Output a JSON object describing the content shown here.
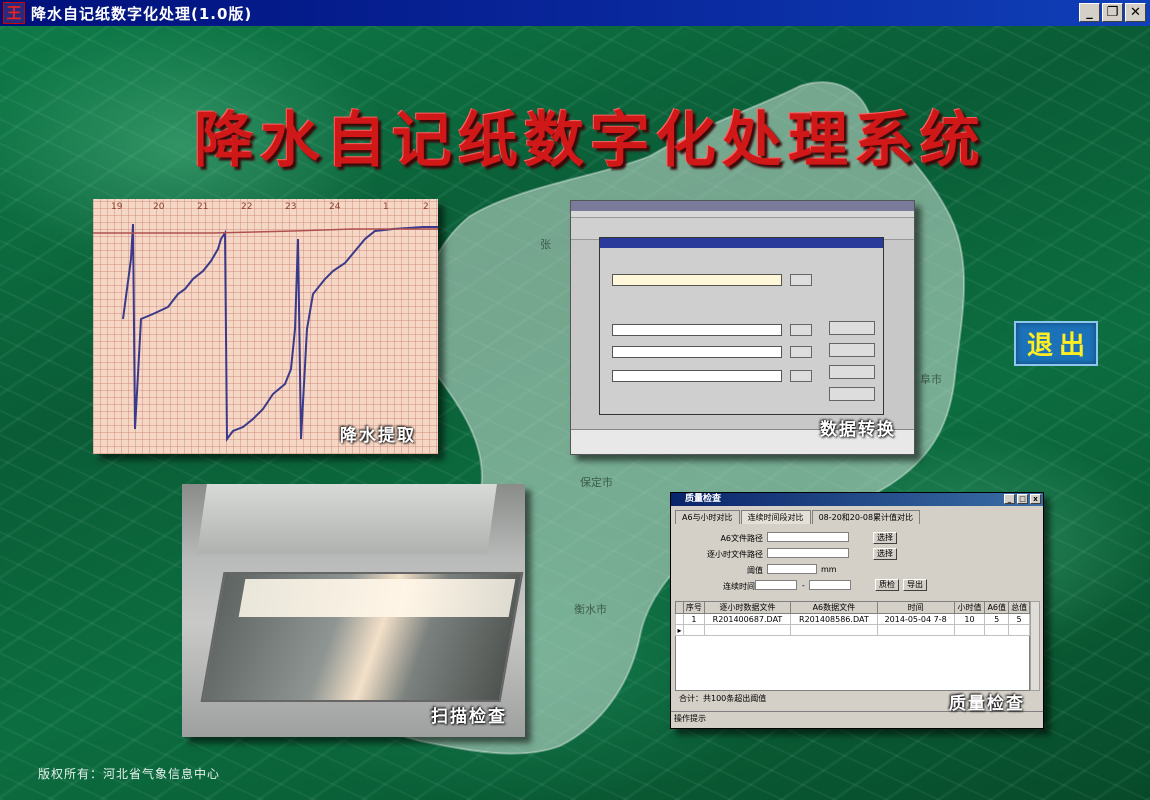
{
  "window": {
    "icon_glyph": "王",
    "title": "降水自记纸数字化处理(1.0版)",
    "minimize_glyph": "_",
    "restore_glyph": "❐",
    "close_glyph": "✕"
  },
  "header": {
    "main_title": "降水自记纸数字化处理系统"
  },
  "map": {
    "cities": [
      "张",
      "保定市",
      "衡水市",
      "阜市"
    ]
  },
  "panels": {
    "extract": {
      "label": "降水提取",
      "tick_labels": [
        "19",
        "20",
        "21",
        "22",
        "23",
        "24",
        "1",
        "2"
      ]
    },
    "convert": {
      "label": "数据转换"
    },
    "scan": {
      "label": "扫描检查"
    },
    "quality": {
      "label": "质量检查"
    }
  },
  "quality_window": {
    "title": "质量检查",
    "tabs": [
      "A6与小时对比",
      "连续时间段对比",
      "08-20和20-08累计值对比"
    ],
    "fields": {
      "a6_label": "A6文件路径",
      "hour_label": "逐小时文件路径",
      "threshold_label": "阈值",
      "threshold_unit": "mm",
      "period_label": "连续时间段",
      "period_sep": "-"
    },
    "buttons": {
      "select1": "选择",
      "select2": "选择",
      "check": "质检",
      "export": "导出"
    },
    "table": {
      "headers": [
        "序号",
        "逐小时数据文件",
        "A6数据文件",
        "时间",
        "小时值",
        "A6值",
        "总值"
      ],
      "rows": [
        [
          "1",
          "R201400687.DAT",
          "R201408586.DAT",
          "2014-05-04 7-8",
          "10",
          "5",
          "5"
        ]
      ]
    },
    "summary": "合计：共100条超出阈值",
    "status": "操作提示"
  },
  "exit_button": "退出",
  "footer": {
    "copyright": "版权所有：河北省气象信息中心"
  },
  "colors": {
    "title_red": "#d01818",
    "exit_text": "#ffee22",
    "exit_bg": "#1c72b8",
    "titlebar": "#0a2aa0"
  }
}
